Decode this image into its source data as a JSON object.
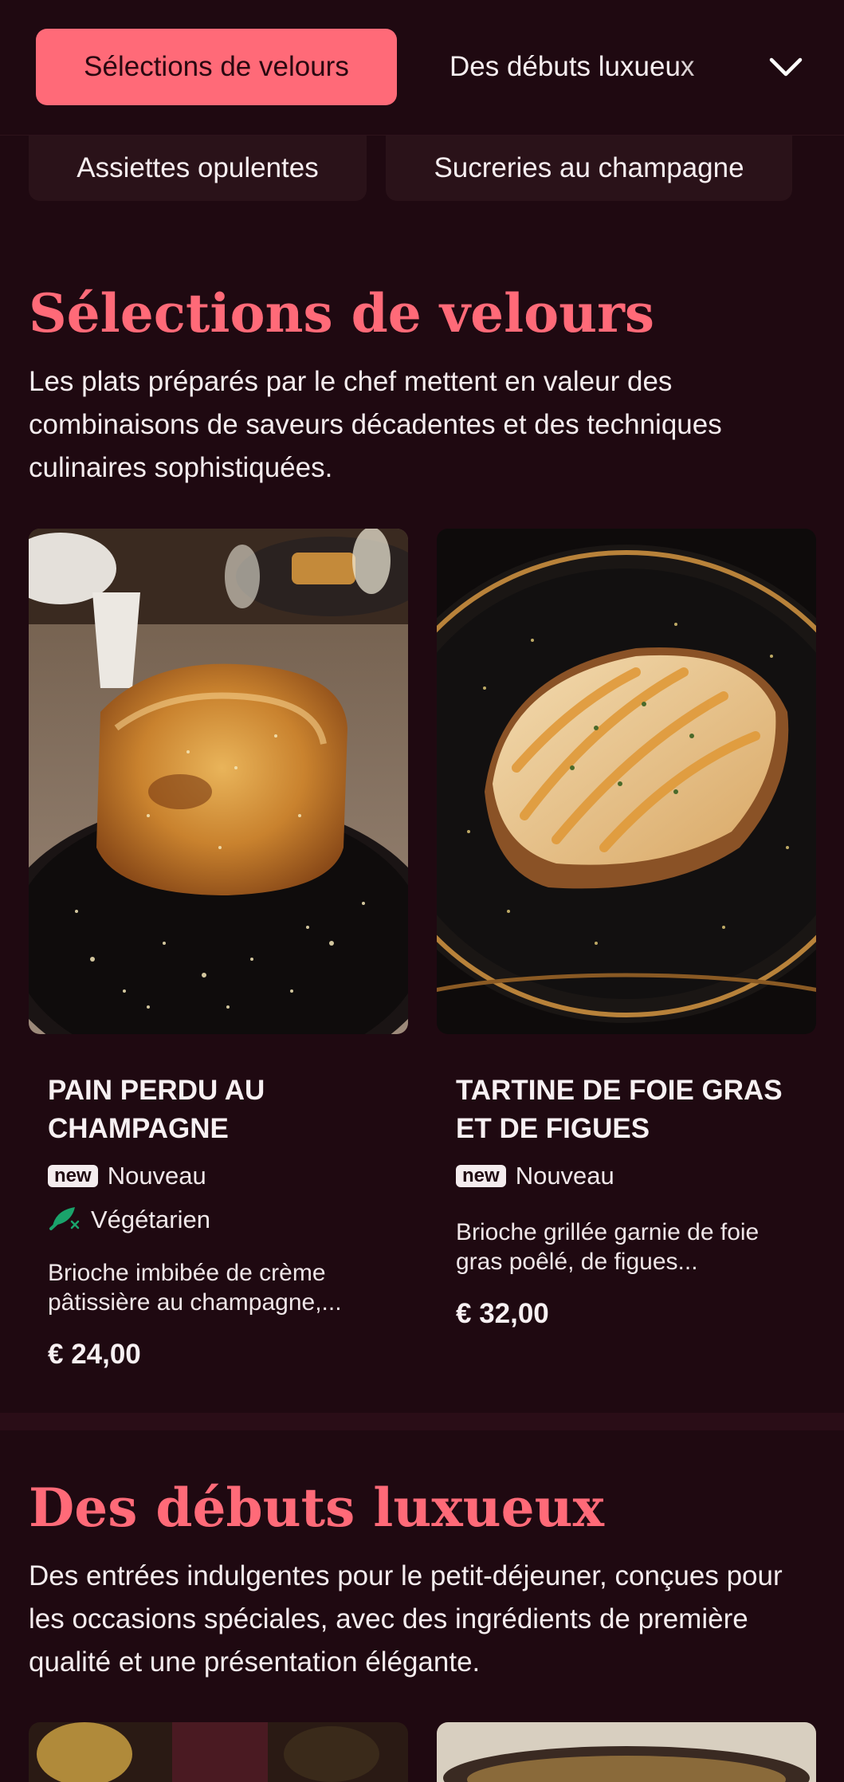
{
  "nav": {
    "active_tab": "Sélections de velours",
    "next_tab": "Des débuts luxueux",
    "sub_tabs": [
      "Assiettes opulentes",
      "Sucreries au champagne"
    ]
  },
  "sections": [
    {
      "title": "Sélections de velours",
      "description": "Les plats préparés par le chef mettent en valeur des combinaisons de saveurs décadentes et des techniques culinaires sophistiquées.",
      "items": [
        {
          "name": "Pain perdu au champagne",
          "new_badge": "new",
          "new_label": "Nouveau",
          "veg_label": "Végétarien",
          "description": "Brioche imbibée de crème pâtissière au champagne,...",
          "price": "€ 24,00"
        },
        {
          "name": "Tartine de foie gras et de figues",
          "new_badge": "new",
          "new_label": "Nouveau",
          "description": "Brioche grillée garnie de foie gras poêlé, de figues...",
          "price": "€ 32,00"
        }
      ]
    },
    {
      "title": "Des débuts luxueux",
      "description": "Des entrées indulgentes pour le petit-déjeuner, conçues pour les occasions spéciales, avec des ingrédients de première qualité et une présentation élégante."
    }
  ],
  "colors": {
    "background": "#1f0911",
    "accent": "#ff6a78",
    "chip": "#2a1219",
    "veg_green": "#1aa36b"
  }
}
